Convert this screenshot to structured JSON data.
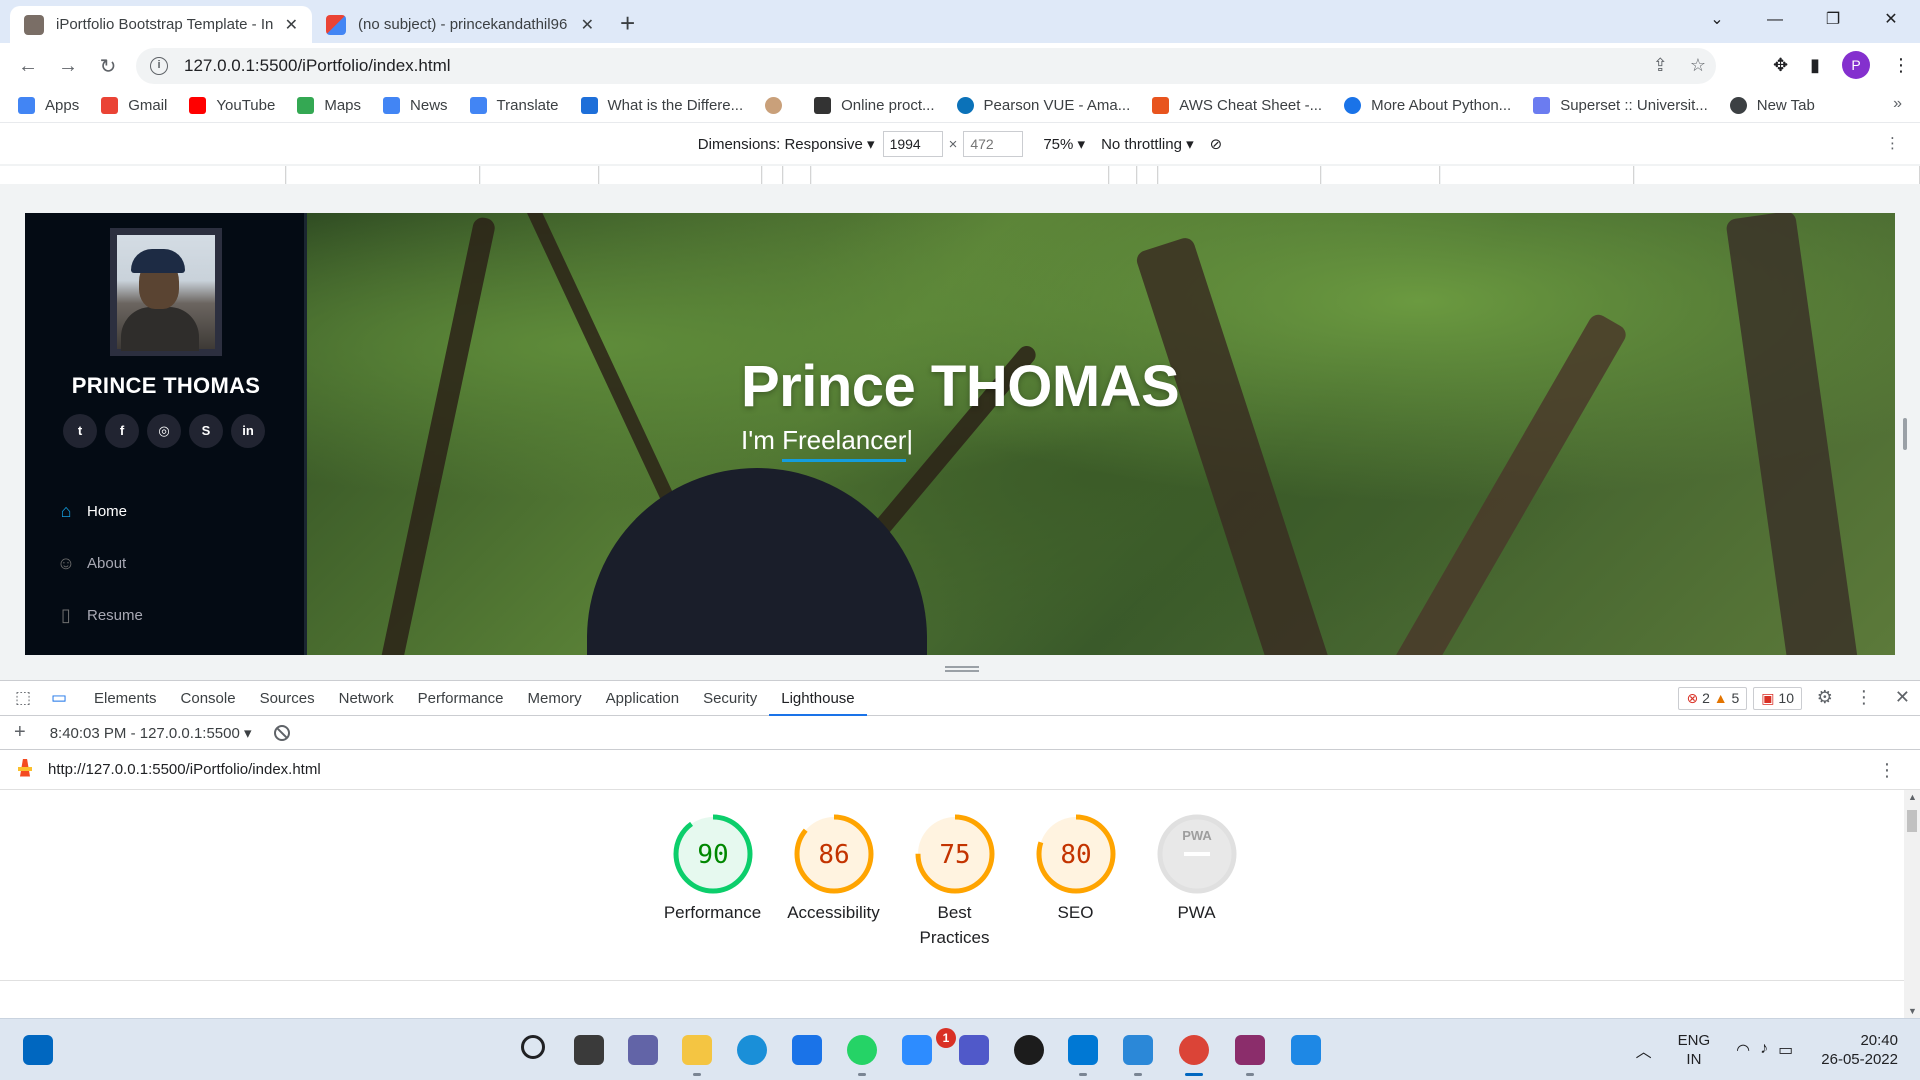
{
  "browser": {
    "tabs": [
      {
        "title": "iPortfolio Bootstrap Template - In",
        "active": true
      },
      {
        "title": "(no subject) - princekandathil96",
        "active": false
      }
    ],
    "url": "127.0.0.1:5500/iPortfolio/index.html",
    "profile_initial": "P",
    "bookmarks": [
      {
        "label": "Apps",
        "icon": "apps-grid-icon",
        "color": "#4285f4"
      },
      {
        "label": "Gmail",
        "icon": "gmail-icon",
        "color": "#ea4335"
      },
      {
        "label": "YouTube",
        "icon": "youtube-icon",
        "color": "#ff0000"
      },
      {
        "label": "Maps",
        "icon": "maps-icon",
        "color": "#34a853"
      },
      {
        "label": "News",
        "icon": "news-icon",
        "color": "#4285f4"
      },
      {
        "label": "Translate",
        "icon": "translate-icon",
        "color": "#4285f4"
      },
      {
        "label": "What is the Differe...",
        "icon": "page-icon",
        "color": "#1e6fd9"
      },
      {
        "label": "",
        "icon": "avatar-icon",
        "color": "#c9a07a"
      },
      {
        "label": "Online proct...",
        "icon": "proctor-icon",
        "color": "#333333"
      },
      {
        "label": "Pearson VUE - Ama...",
        "icon": "pearson-icon",
        "color": "#0b72b9"
      },
      {
        "label": "AWS Cheat Sheet -...",
        "icon": "aws-icon",
        "color": "#e8541e"
      },
      {
        "label": "More About Python...",
        "icon": "c-icon",
        "color": "#1a73e8"
      },
      {
        "label": "Superset :: Universit...",
        "icon": "superset-icon",
        "color": "#6b7cf0"
      },
      {
        "label": "New Tab",
        "icon": "globe-icon",
        "color": "#3c4043"
      }
    ]
  },
  "device_toolbar": {
    "dimensions_label": "Dimensions: Responsive",
    "width": "1994",
    "height_placeholder": "472",
    "zoom": "75%",
    "throttling": "No throttling"
  },
  "site": {
    "name": "PRINCE THOMAS",
    "socials": [
      "twitter",
      "facebook",
      "instagram",
      "skype",
      "linkedin"
    ],
    "social_glyphs": [
      "t",
      "f",
      "◎",
      "S",
      "in"
    ],
    "nav": [
      {
        "label": "Home",
        "icon": "home-icon",
        "active": true
      },
      {
        "label": "About",
        "icon": "user-icon",
        "active": false
      },
      {
        "label": "Resume",
        "icon": "file-icon",
        "active": false
      }
    ],
    "hero_title": "Prince THOMAS",
    "hero_prefix": "I'm ",
    "hero_typed": "Freelancer",
    "accent": "#149ddd"
  },
  "devtools": {
    "tabs": [
      "Elements",
      "Console",
      "Sources",
      "Network",
      "Performance",
      "Memory",
      "Application",
      "Security",
      "Lighthouse"
    ],
    "active_tab": "Lighthouse",
    "errors": "2",
    "warnings": "5",
    "issues": "10",
    "report_time": "8:40:03 PM - 127.0.0.1:5500",
    "report_url": "http://127.0.0.1:5500/iPortfolio/index.html",
    "scores": [
      {
        "label": "Performance",
        "value": "90",
        "score": 90,
        "color": "#0cce6b",
        "text_color": "#008800",
        "bg": "#e6f9ef"
      },
      {
        "label": "Accessibility",
        "value": "86",
        "score": 86,
        "color": "#ffa400",
        "text_color": "#c33300",
        "bg": "#fff3e0"
      },
      {
        "label": "Best Practices",
        "value": "75",
        "score": 75,
        "color": "#ffa400",
        "text_color": "#c33300",
        "bg": "#fff3e0"
      },
      {
        "label": "SEO",
        "value": "80",
        "score": 80,
        "color": "#ffa400",
        "text_color": "#c33300",
        "bg": "#fff3e0"
      },
      {
        "label": "PWA",
        "value": "PWA",
        "score": null,
        "color": "#e0e0e0",
        "text_color": "#9e9e9e",
        "bg": "#e8e8e8"
      }
    ]
  },
  "taskbar": {
    "apps": [
      "start",
      "search",
      "task-view",
      "chat",
      "file-explorer",
      "edge",
      "store",
      "whatsapp",
      "zoom",
      "teams",
      "dell",
      "vscode",
      "notepad",
      "chrome",
      "winrar",
      "photos"
    ],
    "whatsapp_badge": "1",
    "lang_top": "ENG",
    "lang_bottom": "IN",
    "time": "20:40",
    "date": "26-05-2022"
  }
}
